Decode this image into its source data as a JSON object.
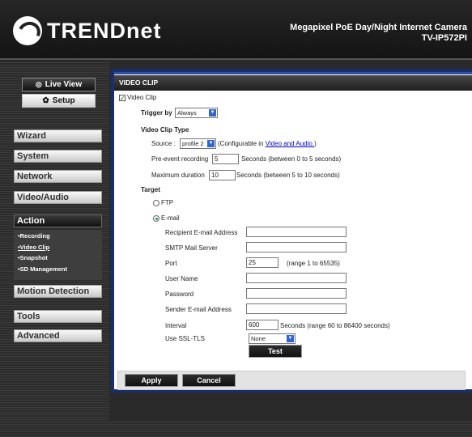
{
  "header": {
    "brand": "TRENDnet",
    "product_line1": "Megapixel PoE Day/Night Internet Camera",
    "product_line2": "TV-IP572PI"
  },
  "sidebar": {
    "live_view": "Live View",
    "setup": "Setup",
    "menu": [
      "Wizard",
      "System",
      "Network",
      "Video/Audio",
      "Action",
      "Motion Detection",
      "Tools",
      "Advanced"
    ],
    "submenu": [
      "•Recording",
      "•Video Clip",
      "•Snapshot",
      "•SD Management"
    ]
  },
  "form": {
    "title": "VIDEO CLIP",
    "enable_label": "Video Clip",
    "enable_checked": true,
    "trigger_label": "Trigger by",
    "trigger_value": "Always",
    "type_heading": "Video Clip Type",
    "source_label": "Source :",
    "source_value": "profile 2",
    "source_note_pre": "(Configurable in ",
    "source_note_link": "Video and Audio.",
    "source_note_post": ")",
    "pre_label": "Pre-event recording",
    "pre_value": "5",
    "pre_note": "Seconds (between 0 to 5 seconds)",
    "max_label": "Maximum duration",
    "max_value": "10",
    "max_note": "Seconds (between 5 to 10 seconds)",
    "target_heading": "Target",
    "ftp_label": "FTP",
    "email_label": "E-mail",
    "recipient_label": "Recipient E-mail Address",
    "recipient_value": "",
    "smtp_label": "SMTP Mail Server",
    "smtp_value": "",
    "port_label": "Port",
    "port_value": "25",
    "port_note": "(range 1 to 65535)",
    "user_label": "User Name",
    "user_value": "",
    "password_label": "Password",
    "password_value": "",
    "sender_label": "Sender E-mail Address",
    "sender_value": "",
    "interval_label": "Interval",
    "interval_value": "600",
    "interval_note": "Seconds  (range 60 to 86400 seconds)",
    "ssl_label": "Use SSL-TLS",
    "ssl_value": "None",
    "test_button": "Test"
  },
  "footer": {
    "apply": "Apply",
    "cancel": "Cancel"
  }
}
